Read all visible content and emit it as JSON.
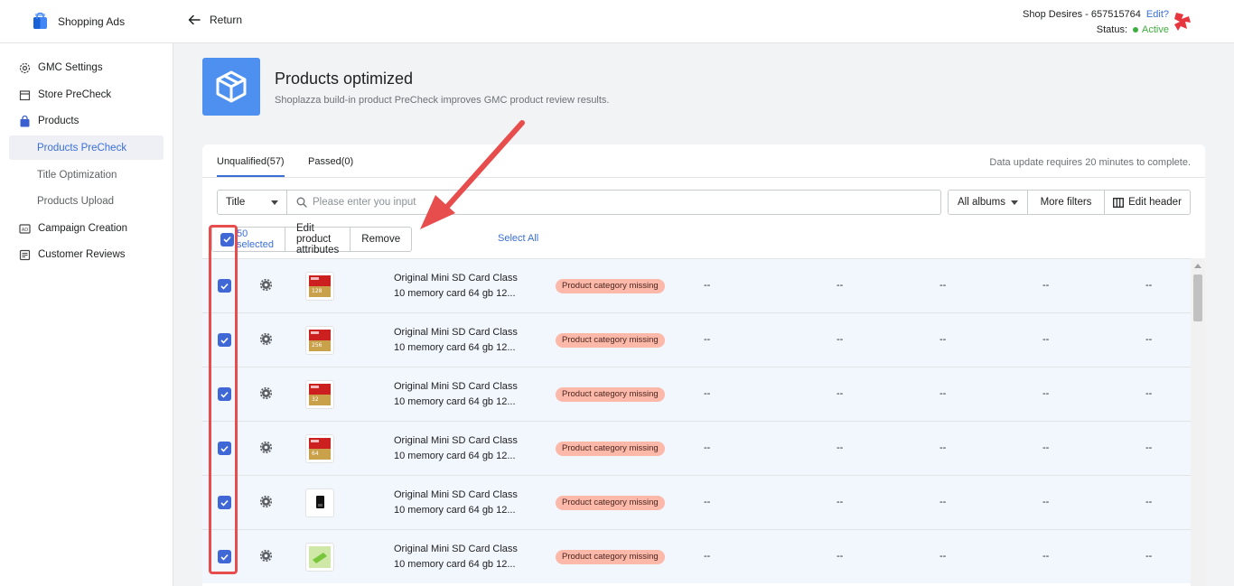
{
  "topbar": {
    "app_name": "Shopping Ads",
    "return_label": "Return",
    "shop_name": "Shop Desires - 657515764",
    "edit_label": "Edit?",
    "status_label": "Status:",
    "status_value": "Active"
  },
  "sidebar": {
    "items": [
      {
        "label": "GMC Settings",
        "icon": "gear-icon"
      },
      {
        "label": "Store PreCheck",
        "icon": "store-icon"
      },
      {
        "label": "Products",
        "icon": "shopping-bag-icon"
      },
      {
        "label": "Campaign Creation",
        "icon": "ad-icon"
      },
      {
        "label": "Customer Reviews",
        "icon": "review-icon"
      }
    ],
    "sub_items": [
      {
        "label": "Products PreCheck",
        "active": true
      },
      {
        "label": "Title Optimization",
        "active": false
      },
      {
        "label": "Products Upload",
        "active": false
      }
    ]
  },
  "header": {
    "title": "Products optimized",
    "subtitle": "Shoplazza build-in product PreCheck improves GMC product review results."
  },
  "tabs": [
    {
      "label": "Unqualified(57)",
      "active": true
    },
    {
      "label": "Passed(0)",
      "active": false
    }
  ],
  "tabs_note": "Data update requires 20 minutes to complete.",
  "filters": {
    "field_select": "Title",
    "search_placeholder": "Please enter you input",
    "albums": "All albums",
    "more_filters": "More filters",
    "edit_header": "Edit header"
  },
  "bulk": {
    "selected": "50 selected",
    "edit_attributes": "Edit product attributes",
    "remove": "Remove",
    "select_all": "Select All"
  },
  "rows": [
    {
      "name_line1": "Original Mini SD Card Class",
      "name_line2": "10 memory card 64 gb 12...",
      "badge": "Product category missing",
      "thumb_label": "128",
      "d1": "--",
      "d2": "--",
      "d3": "--",
      "d4": "--",
      "d5": "--"
    },
    {
      "name_line1": "Original Mini SD Card Class",
      "name_line2": "10 memory card 64 gb 12...",
      "badge": "Product category missing",
      "thumb_label": "256",
      "d1": "--",
      "d2": "--",
      "d3": "--",
      "d4": "--",
      "d5": "--"
    },
    {
      "name_line1": "Original Mini SD Card Class",
      "name_line2": "10 memory card 64 gb 12...",
      "badge": "Product category missing",
      "thumb_label": "32",
      "d1": "--",
      "d2": "--",
      "d3": "--",
      "d4": "--",
      "d5": "--"
    },
    {
      "name_line1": "Original Mini SD Card Class",
      "name_line2": "10 memory card 64 gb 12...",
      "badge": "Product category missing",
      "thumb_label": "64",
      "d1": "--",
      "d2": "--",
      "d3": "--",
      "d4": "--",
      "d5": "--"
    },
    {
      "name_line1": "Original Mini SD Card Class",
      "name_line2": "10 memory card 64 gb 12...",
      "badge": "Product category missing",
      "thumb_label": "",
      "d1": "--",
      "d2": "--",
      "d3": "--",
      "d4": "--",
      "d5": "--"
    },
    {
      "name_line1": "Original Mini SD Card Class",
      "name_line2": "10 memory card 64 gb 12...",
      "badge": "Product category missing",
      "thumb_label": "",
      "d1": "--",
      "d2": "--",
      "d3": "--",
      "d4": "--",
      "d5": "--"
    }
  ],
  "colors": {
    "accent": "#3a6fd8",
    "checkbox": "#3f67d6",
    "badge_bg": "#fcb8a8",
    "annotation": "#e84d4d",
    "active_status": "#3eae3e"
  }
}
